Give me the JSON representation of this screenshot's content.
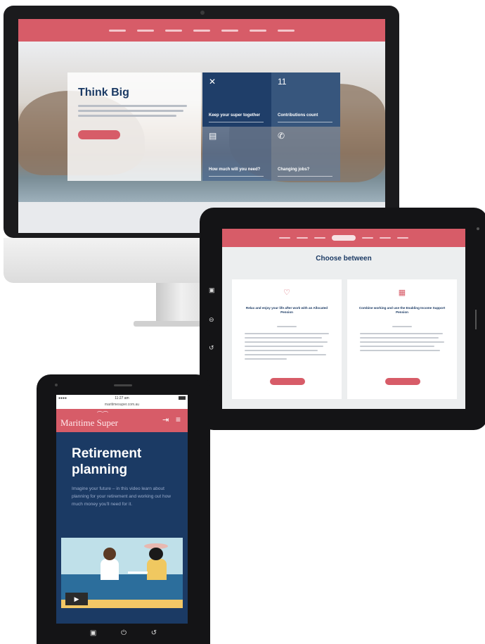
{
  "desktop": {
    "hero_title": "Think Big",
    "tiles": [
      {
        "icon": "✕",
        "title": "Keep your super together"
      },
      {
        "icon": "11",
        "title": "Contributions count"
      },
      {
        "icon": "▤",
        "title": "How much will you need?"
      },
      {
        "icon": "✆",
        "title": "Changing jobs?"
      }
    ]
  },
  "tablet": {
    "title": "Choose between",
    "cards": [
      {
        "icon": "♡",
        "heading": "Relax and enjoy your life after work with an Allocated Pension"
      },
      {
        "icon": "▦",
        "heading": "Combine working and use the Enabling Income Support Pension"
      }
    ],
    "side_buttons": [
      "▣",
      "⊖",
      "↺"
    ]
  },
  "phone": {
    "url": "maritimesuper.com.au",
    "time": "11:27 am",
    "brand": "Maritime Super",
    "title": "Retirement planning",
    "body": "Imagine your future – in this video learn about planning for your retirement and working out how much money you'll need for it.",
    "play_icon": "▶",
    "home_buttons": [
      "▣",
      "⏻",
      "↺"
    ]
  },
  "colors": {
    "brand_red": "#d75c68",
    "navy": "#1b3a64"
  }
}
